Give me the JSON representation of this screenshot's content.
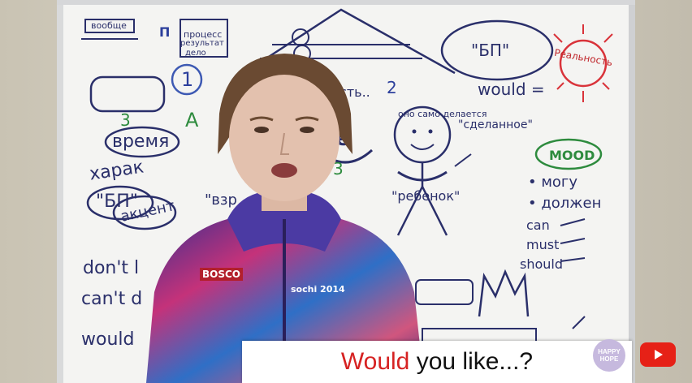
{
  "caption": {
    "accent": "Would",
    "rest": " you like...?"
  },
  "badge": {
    "line1": "HAPPY",
    "line2": "HOPE"
  },
  "board_text": {
    "would_right": "would =",
    "mood": "MOOD",
    "mogu": "• могу",
    "dolzhen": "• должен",
    "can": "can",
    "must": "must",
    "should": "should",
    "realnost": "Реальность",
    "bp": "\"БП\"",
    "vremya": "время",
    "harak": "харак",
    "akcent": "акцент",
    "dont": "don't l",
    "cant": "can't d",
    "would_left": "would",
    "rebenok": "\"ребенок\"",
    "sdelannoe": "\"сделанное\"",
    "ono_samo": "оно само делается",
    "ya_est": "Я есть..",
    "ve": "ve",
    "process": "процесс",
    "rezultat": "результат",
    "delo": "дело",
    "voobshe": "вообще",
    "bosco": "BOSCO",
    "sochi": "sochi 2014",
    "vzr": "\"взр",
    "one": "1",
    "two": "2",
    "three_a": "3",
    "three_b": "3",
    "A": "A",
    "P": "П"
  },
  "colors": {
    "caption_accent": "#d62222",
    "youtube": "#e62117",
    "badge": "#c6b9de"
  },
  "icons": {
    "youtube": "youtube-logo-icon"
  }
}
